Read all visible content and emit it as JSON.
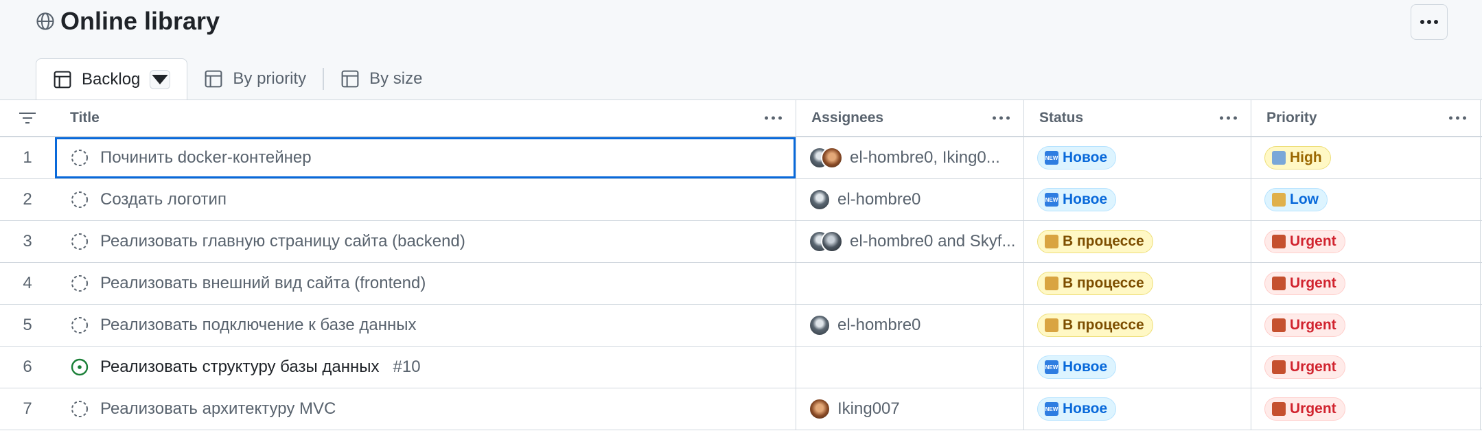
{
  "header": {
    "title": "Online library"
  },
  "tabs": [
    {
      "label": "Backlog",
      "active": true
    },
    {
      "label": "By priority",
      "active": false
    },
    {
      "label": "By size",
      "active": false
    }
  ],
  "columns": {
    "title": "Title",
    "assignees": "Assignees",
    "status": "Status",
    "priority": "Priority"
  },
  "rows": [
    {
      "num": "1",
      "title": "Починить docker-контейнер",
      "issue_ref": "",
      "assignees": "el-hombre0, Iking0...",
      "status": "Новое",
      "priority": "High"
    },
    {
      "num": "2",
      "title": "Создать логотип",
      "issue_ref": "",
      "assignees": "el-hombre0",
      "status": "Новое",
      "priority": "Low"
    },
    {
      "num": "3",
      "title": "Реализовать главную страницу сайта (backend)",
      "issue_ref": "",
      "assignees": "el-hombre0 and Skyf...",
      "status": "В процессе",
      "priority": "Urgent"
    },
    {
      "num": "4",
      "title": "Реализовать внешний вид сайта (frontend)",
      "issue_ref": "",
      "assignees": "",
      "status": "В процессе",
      "priority": "Urgent"
    },
    {
      "num": "5",
      "title": "Реализовать подключение к базе данных",
      "issue_ref": "",
      "assignees": "el-hombre0",
      "status": "В процессе",
      "priority": "Urgent"
    },
    {
      "num": "6",
      "title": "Реализовать структуру базы данных",
      "issue_ref": "#10",
      "assignees": "",
      "status": "Новое",
      "priority": "Urgent"
    },
    {
      "num": "7",
      "title": "Реализовать архитектуру MVC",
      "issue_ref": "",
      "assignees": "Iking007",
      "status": "Новое",
      "priority": "Urgent"
    }
  ],
  "colors": {
    "accent": "#0969da",
    "open_issue": "#1a7f37"
  }
}
